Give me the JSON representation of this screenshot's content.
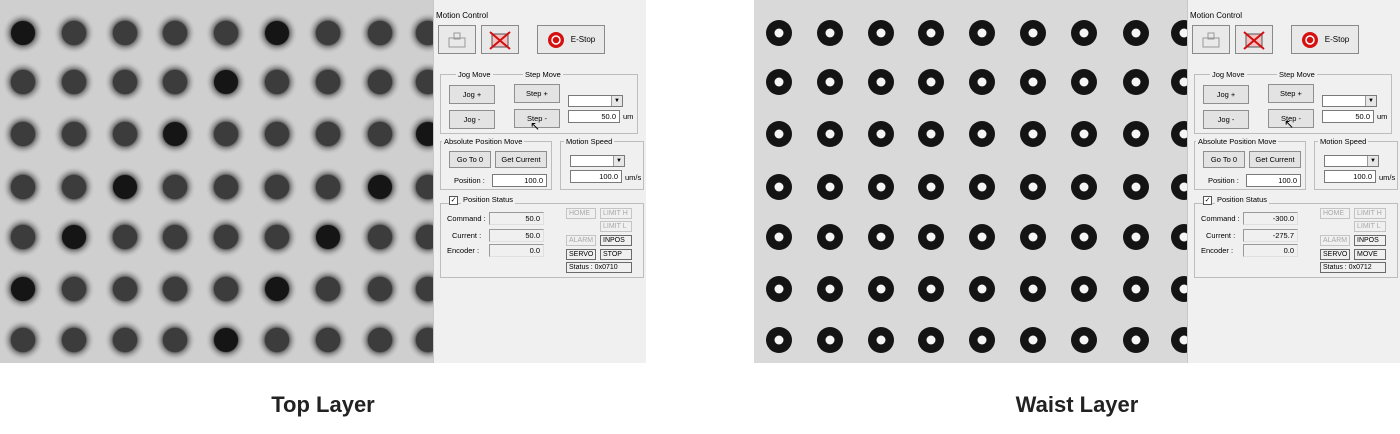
{
  "panels": [
    {
      "caption": "Top Layer",
      "window_title": "Motion Control",
      "toolbar": {
        "estop_label": "E-Stop"
      },
      "jog": {
        "group_label": "Jog Move",
        "plus": "Jog +",
        "minus": "Jog -"
      },
      "step": {
        "group_label": "Step Move",
        "plus": "Step +",
        "minus": "Step -",
        "distance": "50.0",
        "unit": "um"
      },
      "abs": {
        "group_label": "Absolute Position Move",
        "goto0": "Go To 0",
        "get_current": "Get Current",
        "position_label": "Position :",
        "position": "100.0"
      },
      "speed": {
        "group_label": "Motion Speed",
        "value": "100.0",
        "unit": "um/s"
      },
      "status": {
        "group_label": "Position Status",
        "command_label": "Command :",
        "command": "50.0",
        "current_label": "Current :",
        "current": "50.0",
        "encoder_label": "Encoder :",
        "encoder": "0.0",
        "home": "HOME",
        "limit_h": "LIMIT H",
        "limit_l": "LIMIT L",
        "alarm": "ALARM",
        "inpos": "INPOS",
        "servo": "SERVO",
        "state": "STOP",
        "code": "Status : 0x0710"
      }
    },
    {
      "caption": "Waist Layer",
      "window_title": "Motion Control",
      "toolbar": {
        "estop_label": "E-Stop"
      },
      "jog": {
        "group_label": "Jog Move",
        "plus": "Jog +",
        "minus": "Jog -"
      },
      "step": {
        "group_label": "Step Move",
        "plus": "Step +",
        "minus": "Step -",
        "distance": "50.0",
        "unit": "um"
      },
      "abs": {
        "group_label": "Absolute Position Move",
        "goto0": "Go To 0",
        "get_current": "Get Current",
        "position_label": "Position :",
        "position": "100.0"
      },
      "speed": {
        "group_label": "Motion Speed",
        "value": "100.0",
        "unit": "um/s"
      },
      "status": {
        "group_label": "Position Status",
        "command_label": "Command :",
        "command": "-300.0",
        "current_label": "Current :",
        "current": "-275.7",
        "encoder_label": "Encoder :",
        "encoder": "0.0",
        "home": "HOME",
        "limit_h": "LIMIT H",
        "limit_l": "LIMIT L",
        "alarm": "ALARM",
        "inpos": "INPOS",
        "servo": "SERVO",
        "state": "MOVE",
        "code": "Status : 0x0712"
      }
    }
  ]
}
